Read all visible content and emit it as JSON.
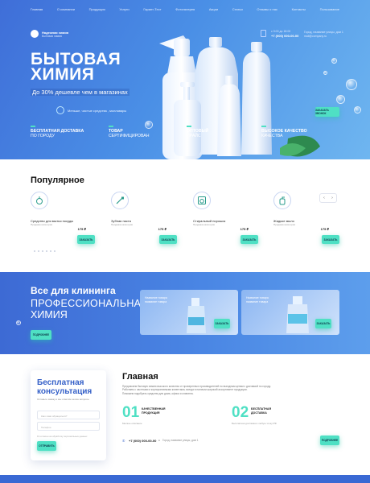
{
  "nav": [
    "Главная",
    "О компании",
    "Продукция",
    "Услуги",
    "Гарант-Тест",
    "Фотогалерея",
    "Акции",
    "Статьи",
    "Отзывы о нас",
    "Контакты",
    "Пользование"
  ],
  "header": {
    "brand": "Надежная химия",
    "brand_sub": "Бытовая химия",
    "hours": "с 9:00 до 18:00",
    "phone": "+7 (000) 000-00-00",
    "address": "Город, название улицы, дом 1",
    "email": "mail@company.ru"
  },
  "hero": {
    "title_line1": "БЫТОВАЯ",
    "title_line2": "ХИМИЯ",
    "subtitle": "До 30% дешевле чем в магазинах",
    "badge_text": "Меньше, чистые средства , моллавары",
    "cta": "ЗАКАЗАТЬ ЗВОНОК",
    "features": [
      {
        "bold": "БЕСПЛАТНАЯ ДОСТАВКА",
        "normal": "ПО ГОРОДУ"
      },
      {
        "bold": "ТОВАР",
        "normal": "СЕРТИФИЦИРОВАН"
      },
      {
        "bold": "ОПТОВЫЙ",
        "normal": "ПРАЙС"
      },
      {
        "bold": "ВЫСОКОЕ КАЧЕСТВО",
        "normal": "КАЧЕСТВА"
      }
    ]
  },
  "popular": {
    "title": "Популярное",
    "products": [
      {
        "name": "Средство для мытья посуды",
        "category": "Продажа категория",
        "price": "175 ₽",
        "button": "ЗАКАЗАТЬ",
        "icon": "dish-icon"
      },
      {
        "name": "Зубная паста",
        "category": "Продажа категория",
        "price": "175 ₽",
        "button": "ЗАКАЗАТЬ",
        "icon": "toothbrush-icon"
      },
      {
        "name": "Стиральный порошок",
        "category": "Продажа категория",
        "price": "175 ₽",
        "button": "ЗАКАЗАТЬ",
        "icon": "washing-machine-icon"
      },
      {
        "name": "Жидкое мыло",
        "category": "Продажа категория",
        "price": "175 ₽",
        "button": "ЗАКАЗАТЬ",
        "icon": "soap-icon"
      }
    ]
  },
  "cleaning": {
    "title": "Все для клининга",
    "line2": "ПРОФЕССИОНАЛЬНАЯ",
    "line3": "ХИМИЯ",
    "button": "ПОДРОБНЕЕ",
    "cards": [
      {
        "caption": "Название товара",
        "caption2": "название товара",
        "button": "ЗАКАЗАТЬ"
      },
      {
        "caption": "Название товара",
        "caption2": "название товара",
        "button": "ЗАКАЗАТЬ"
      }
    ]
  },
  "consult": {
    "title_line1": "Бесплатная",
    "title_line2": "консультация",
    "desc": "Оставьте заявку и мы ответим на все вопросы",
    "name_placeholder": "Как к вам обращаться?",
    "phone_placeholder": "Телефон",
    "agree": "Я согласен на обработку персональных данных",
    "button": "ОТПРАВИТЬ"
  },
  "main": {
    "title": "Главная",
    "text1": "Предлагаем бытовую химию высокого качества от проверенных производителей по выгодным ценам с доставкой по городу.",
    "text2": "Работаем с частными и корпоративными клиентами, всегда в наличии широкий ассортимент продукции.",
    "text3": "Поможем подобрать средства для дома, офиса и клининга.",
    "stat1_num": "01",
    "stat1_label": "КАЧЕСТВЕННАЯ ПРОДУКЦИЯ",
    "stat1_small": "Мелкое описание",
    "stat2_num": "02",
    "stat2_label": "БЕСПЛАТНАЯ ДОСТАВКА",
    "stat2_small": "Бесплатная доставка в любую точку РФ",
    "phone": "+7 (000) 000-00-00",
    "address": "Город, название улицы, дом 1",
    "button": "ПОДРОБНЕЕ"
  },
  "colors": {
    "accent": "#4fe0c4",
    "blue": "#3f6ed8",
    "title_blue": "#3560c8"
  }
}
